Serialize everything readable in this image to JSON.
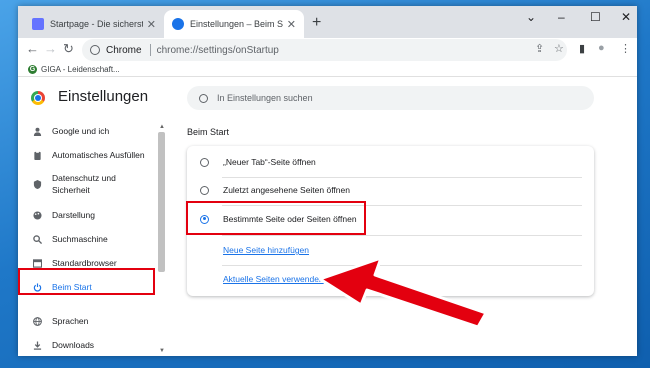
{
  "tabs": [
    {
      "title": "Startpage - Die sicherste Suchma",
      "close": "✕"
    },
    {
      "title": "Einstellungen – Beim Start",
      "close": "✕"
    }
  ],
  "new_tab": "+",
  "window_controls": {
    "collapse": "⌄",
    "minimize": "–",
    "maximize": "☐",
    "close": "✕"
  },
  "nav": {
    "back": "←",
    "forward": "→",
    "reload": "↻"
  },
  "omnibox": {
    "chip": "Chrome",
    "url": "chrome://settings/onStartup"
  },
  "toolbar_icons": {
    "share": "⇪",
    "star": "☆",
    "sidepanel": "▮",
    "profile": "●",
    "menu": "⋮"
  },
  "bookmarks": [
    {
      "label": "GIGA - Leidenschaft..."
    }
  ],
  "settings": {
    "title": "Einstellungen",
    "search_placeholder": "In Einstellungen suchen"
  },
  "sidebar": {
    "items": [
      {
        "label": "Google und ich",
        "icon": "person-icon"
      },
      {
        "label": "Automatisches Ausfüllen",
        "icon": "clipboard-icon"
      },
      {
        "label": "Datenschutz und Sicherheit",
        "icon": "shield-icon"
      },
      {
        "label": "Darstellung",
        "icon": "palette-icon"
      },
      {
        "label": "Suchmaschine",
        "icon": "search-icon"
      },
      {
        "label": "Standardbrowser",
        "icon": "browser-icon"
      },
      {
        "label": "Beim Start",
        "icon": "power-icon"
      },
      {
        "label": "Sprachen",
        "icon": "globe-icon"
      },
      {
        "label": "Downloads",
        "icon": "download-icon"
      }
    ]
  },
  "main": {
    "section_title": "Beim Start",
    "options": [
      {
        "label": "„Neuer Tab“-Seite öffnen",
        "selected": false
      },
      {
        "label": "Zuletzt angesehene Seiten öffnen",
        "selected": false
      },
      {
        "label": "Bestimmte Seite oder Seiten öffnen",
        "selected": true
      }
    ],
    "links": {
      "add_page": "Neue Seite hinzufügen",
      "use_current": "Aktuelle Seiten verwenden"
    }
  },
  "colors": {
    "accent": "#1a73e8",
    "highlight": "#e3000f"
  }
}
